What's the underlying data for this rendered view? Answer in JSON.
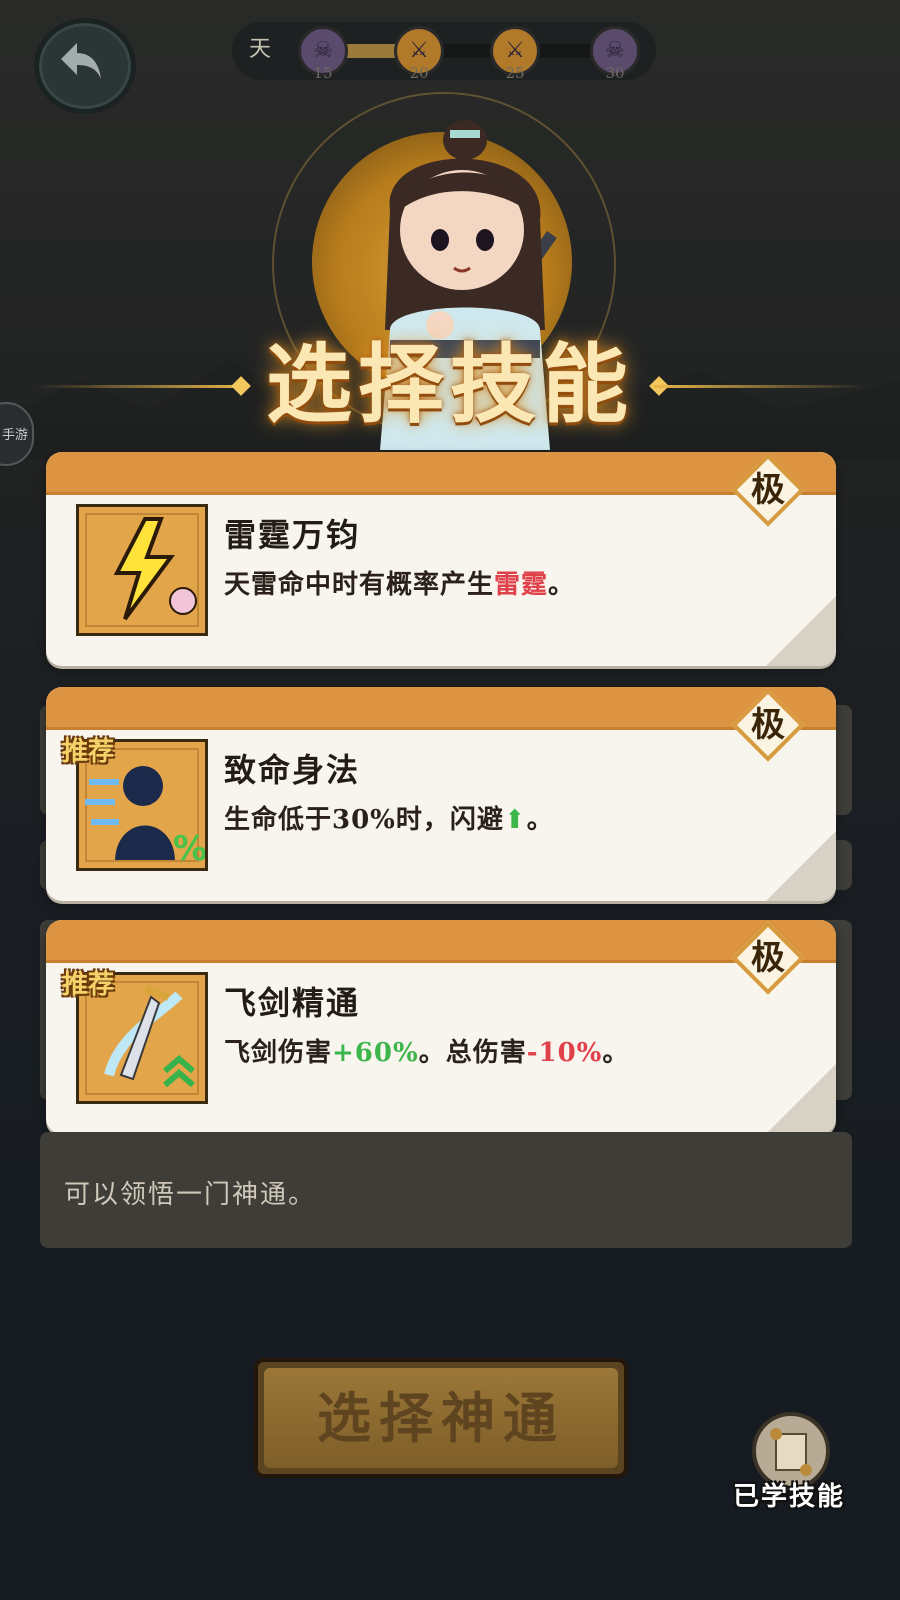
{
  "topbar": {
    "day_label": "天",
    "progress_fraction": 0.45,
    "nodes": [
      {
        "type": "skull",
        "num": "15"
      },
      {
        "type": "sword",
        "num": "20"
      },
      {
        "type": "sword",
        "num": "25"
      },
      {
        "type": "skull",
        "num": "30"
      }
    ]
  },
  "side_tag": "手游",
  "title": "选择技能",
  "cards": [
    {
      "name": "雷霆万钧",
      "desc_parts": [
        {
          "t": "天雷命中时有概率产生",
          "c": ""
        },
        {
          "t": "雷霆",
          "c": "red"
        },
        {
          "t": "。",
          "c": ""
        }
      ],
      "rank": "极",
      "recommended": "",
      "icon": "lightning-icon"
    },
    {
      "name": "致命身法",
      "desc_parts": [
        {
          "t": "生命低于30%时，闪避",
          "c": ""
        },
        {
          "t": "⬆",
          "c": "green"
        },
        {
          "t": "。",
          "c": ""
        }
      ],
      "rank": "极",
      "recommended": "推荐",
      "icon": "shadow-figure-icon"
    },
    {
      "name": "飞剑精通",
      "desc_parts": [
        {
          "t": "飞剑伤害",
          "c": ""
        },
        {
          "t": "+60%",
          "c": "green"
        },
        {
          "t": "。总伤害",
          "c": ""
        },
        {
          "t": "-10%",
          "c": "red"
        },
        {
          "t": "。",
          "c": ""
        }
      ],
      "rank": "极",
      "recommended": "推荐",
      "icon": "flying-sword-icon"
    }
  ],
  "info_text": "可以领悟一门神通。",
  "choose_button": "选择神通",
  "learned_skills": "已学技能",
  "colors": {
    "card_band": "#dd9442",
    "title": "#fbe7b4",
    "button": "#8a6a30"
  }
}
